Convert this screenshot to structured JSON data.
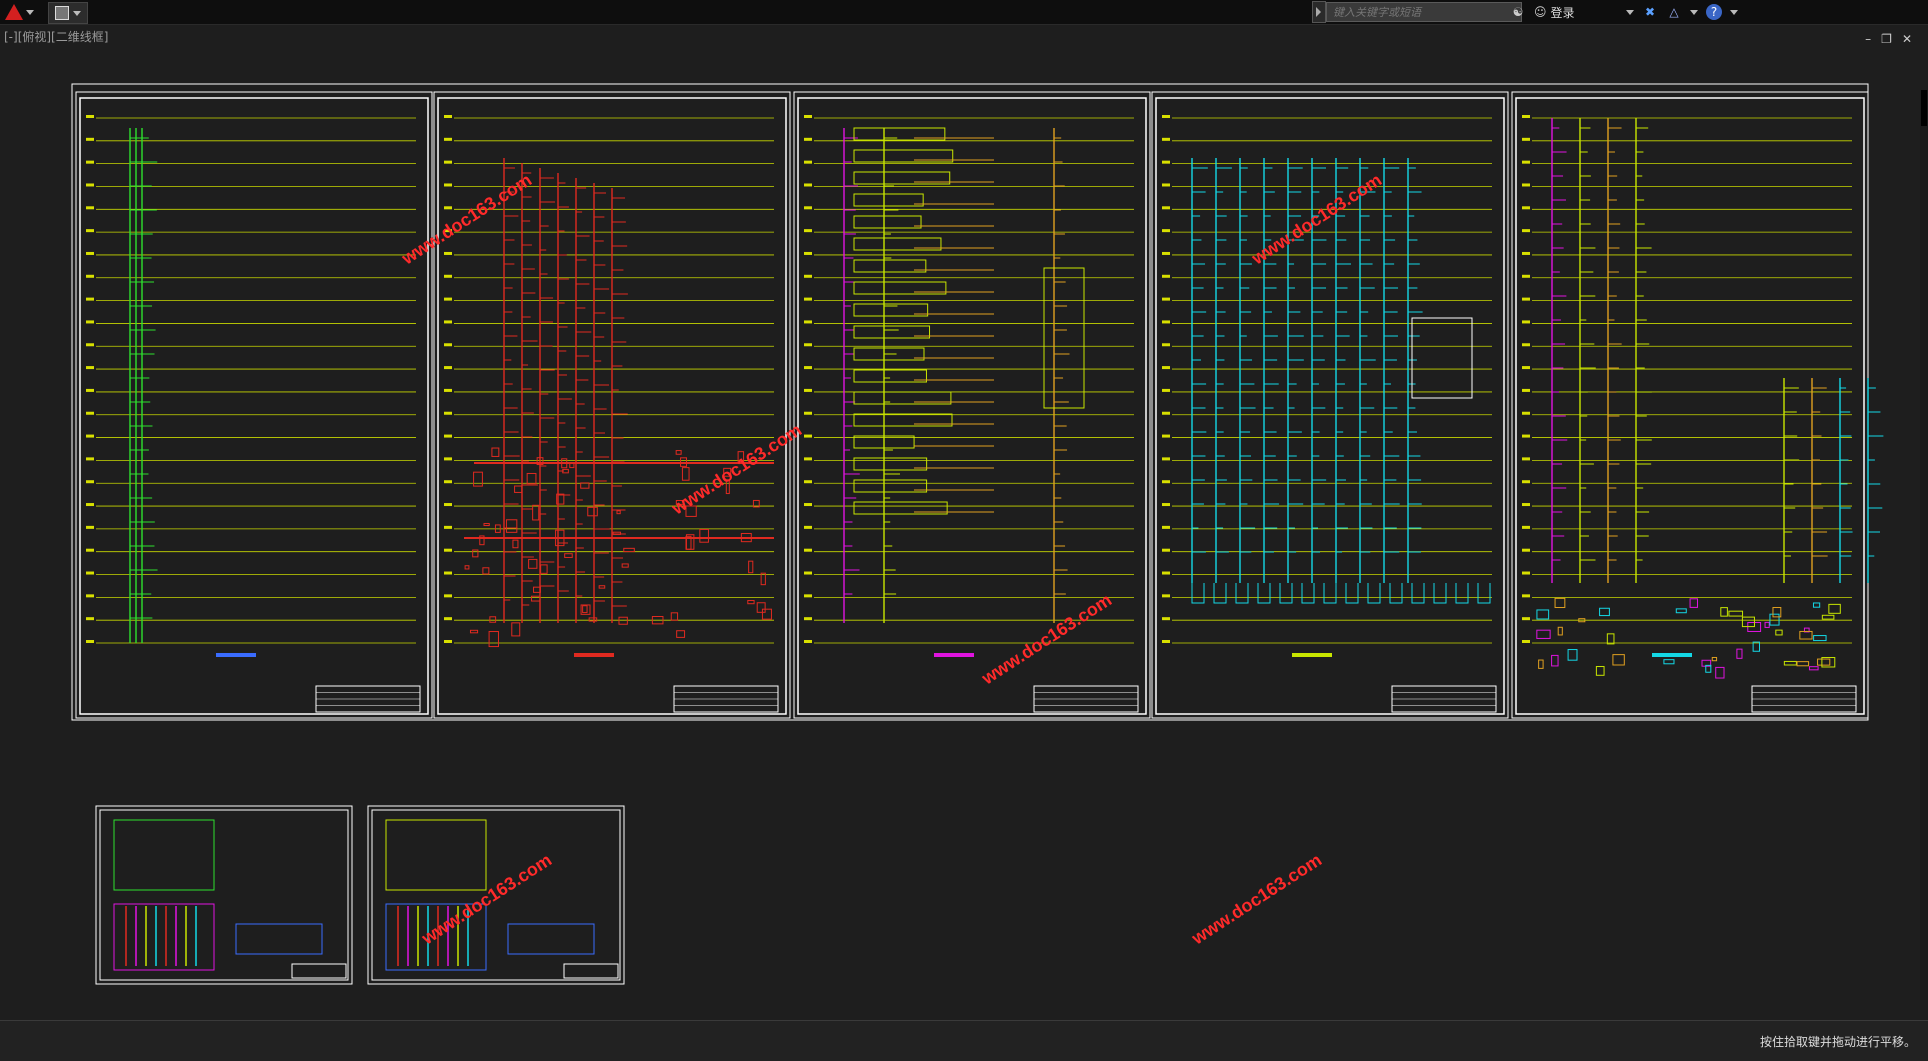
{
  "toolbar": {
    "search_placeholder": "键入关键字或短语",
    "login_label": "登录"
  },
  "viewport": {
    "label": "[-][俯视][二维线框]"
  },
  "status": {
    "message": "按住拾取键并拖动进行平移。"
  },
  "drawing": {
    "watermark": "www.doc163.com",
    "colors": {
      "border": "#ffffff",
      "floor_line": "#c8d800",
      "green": "#2ee02e",
      "red": "#e02a20",
      "yellow_green": "#c8e600",
      "cyan": "#14d8e6",
      "magenta": "#e014e0",
      "orange": "#e0a020",
      "blue": "#3a6cff",
      "watermark": "#ff2a2a"
    },
    "floors": 24
  }
}
